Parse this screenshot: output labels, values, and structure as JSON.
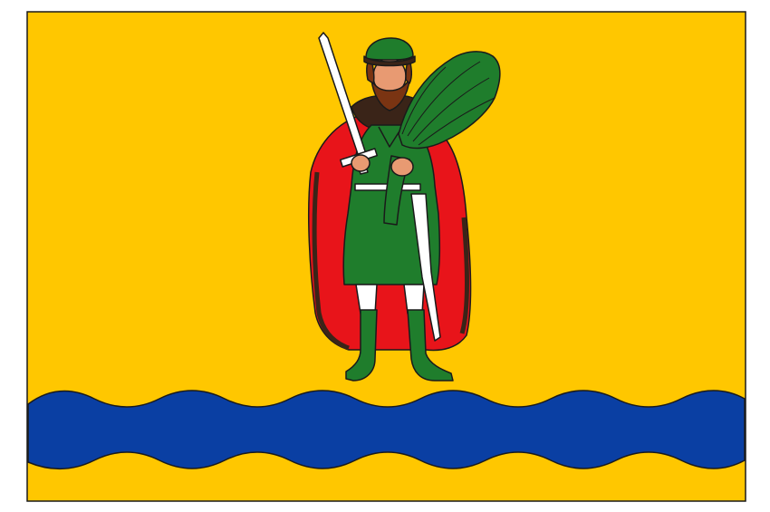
{
  "flag": {
    "colors": {
      "field": "#ffc700",
      "river": "#0a3fa3",
      "outline": "#1a1a1a",
      "cloak": "#e8141a",
      "tunic": "#1f7d2c",
      "hat": "#1f7d2c",
      "fur": "#3a2418",
      "beard": "#7a3412",
      "skin": "#e89a72",
      "metal": "#ffffff",
      "sheaf": "#1f7d2c"
    },
    "icons": [
      "warrior-figure-icon",
      "sword-icon",
      "wheat-sheaf-icon",
      "scabbard-icon",
      "wavy-river-icon"
    ]
  }
}
